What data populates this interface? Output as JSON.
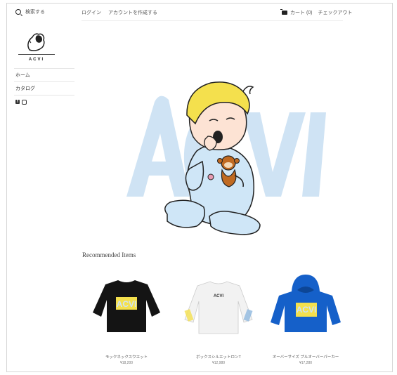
{
  "header": {
    "search_label": "検索する",
    "login_label": "ログイン",
    "create_account_label": "アカウントを作成する",
    "cart_label": "カート (0)",
    "checkout_label": "チェックアウト"
  },
  "brand": {
    "logo_text": "ACVI"
  },
  "sidebar": {
    "items": [
      {
        "label": "ホーム"
      },
      {
        "label": "カタログ"
      }
    ],
    "social": [
      "facebook-icon",
      "instagram-icon"
    ]
  },
  "hero": {
    "watermark_text": "ACVI"
  },
  "recommended": {
    "title": "Recommended Items",
    "products": [
      {
        "name": "モックネックスウエット",
        "price": "¥18,200",
        "color": "#141414"
      },
      {
        "name": "ボックスシルエットロンT",
        "price": "¥12,980",
        "color": "#f2f2f2"
      },
      {
        "name": "オーバーサイズ プルオーバーパーカー",
        "price": "¥17,280",
        "color": "#1560c9"
      }
    ]
  },
  "colors": {
    "hero_blue": "#cfe3f4",
    "hair": "#f4e04d",
    "monkey": "#c06a22"
  }
}
